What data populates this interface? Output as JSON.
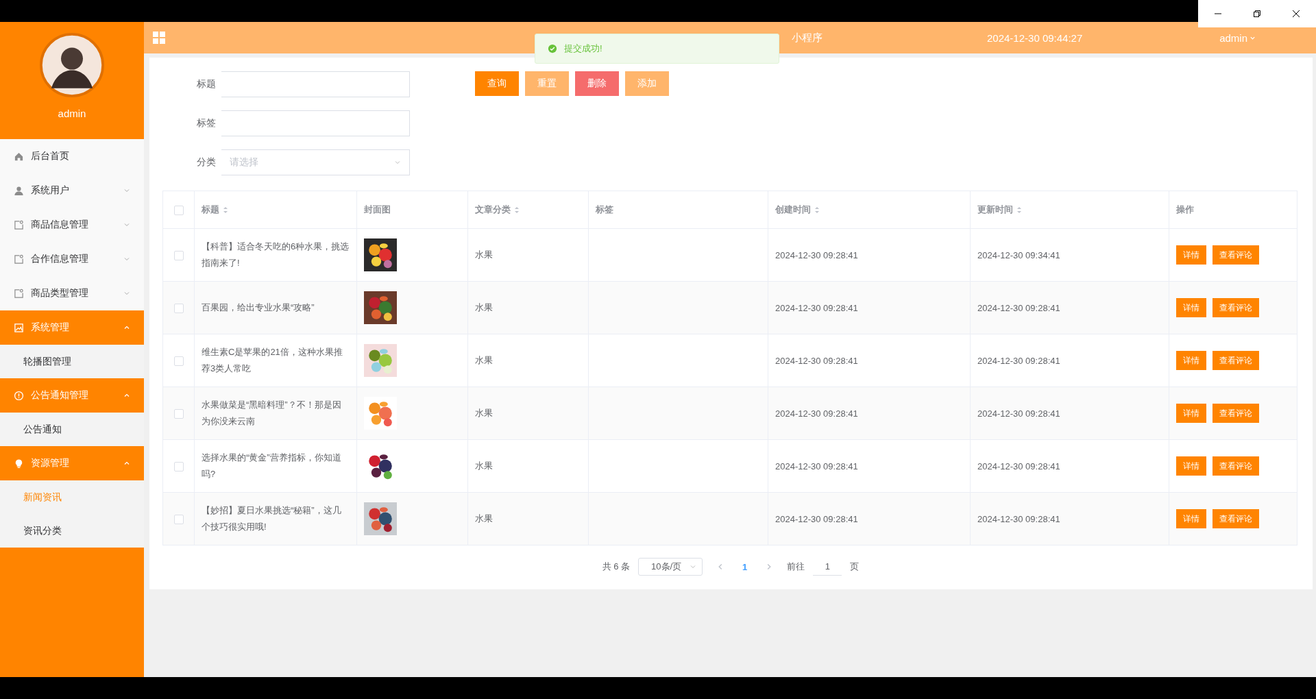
{
  "header": {
    "title": "小程序",
    "datetime": "2024-12-30 09:44:27",
    "user": "admin"
  },
  "toast": {
    "kind": "success",
    "text": "提交成功!"
  },
  "sidebar": {
    "username": "admin",
    "items": [
      {
        "label": "后台首页",
        "kind": "link",
        "expanded": false
      },
      {
        "label": "系统用户",
        "kind": "submenu",
        "expanded": false
      },
      {
        "label": "商品信息管理",
        "kind": "submenu",
        "expanded": false
      },
      {
        "label": "合作信息管理",
        "kind": "submenu",
        "expanded": false
      },
      {
        "label": "商品类型管理",
        "kind": "submenu",
        "expanded": false
      },
      {
        "label": "系统管理",
        "kind": "submenu",
        "expanded": true,
        "children": [
          {
            "label": "轮播图管理",
            "selected": false
          }
        ]
      },
      {
        "label": "公告通知管理",
        "kind": "submenu",
        "expanded": true,
        "children": [
          {
            "label": "公告通知",
            "selected": false
          }
        ]
      },
      {
        "label": "资源管理",
        "kind": "submenu",
        "expanded": true,
        "children": [
          {
            "label": "新闻资讯",
            "selected": true
          },
          {
            "label": "资讯分类",
            "selected": false
          }
        ]
      }
    ]
  },
  "filters": [
    {
      "label": "标题",
      "kind": "input"
    },
    {
      "label": "标签",
      "kind": "input"
    },
    {
      "label": "分类",
      "kind": "select",
      "placeholder": "请选择"
    }
  ],
  "buttons": [
    {
      "label": "查询",
      "kind": "primary"
    },
    {
      "label": "重置",
      "kind": "light"
    },
    {
      "label": "删除",
      "kind": "danger"
    },
    {
      "label": "添加",
      "kind": "light"
    }
  ],
  "table": {
    "select_all": {
      "checked": false
    },
    "columns": [
      {
        "label": "标题",
        "sortable": true
      },
      {
        "label": "封面图",
        "sortable": false
      },
      {
        "label": "文章分类",
        "sortable": true
      },
      {
        "label": "标签",
        "sortable": false
      },
      {
        "label": "创建时间",
        "sortable": true
      },
      {
        "label": "更新时间",
        "sortable": true
      },
      {
        "label": "操作",
        "sortable": false
      }
    ],
    "rows": [
      {
        "checked": false,
        "title": "【科普】适合冬天吃的6种水果，挑选指南来了!",
        "category": "水果",
        "created": "2024-12-30 09:28:41",
        "updated": "2024-12-30 09:34:41",
        "actions": [
          "详情",
          "查看评论"
        ]
      },
      {
        "checked": false,
        "title": "百果园，给出专业水果“攻略”",
        "category": "水果",
        "created": "2024-12-30 09:28:41",
        "updated": "2024-12-30 09:28:41",
        "actions": [
          "详情",
          "查看评论"
        ]
      },
      {
        "checked": false,
        "title": "维生素C是苹果的21倍，这种水果推荐3类人常吃",
        "category": "水果",
        "created": "2024-12-30 09:28:41",
        "updated": "2024-12-30 09:28:41",
        "actions": [
          "详情",
          "查看评论"
        ]
      },
      {
        "checked": false,
        "title": "水果做菜是“黑暗料理”？不！那是因为你没来云南",
        "category": "水果",
        "created": "2024-12-30 09:28:41",
        "updated": "2024-12-30 09:28:41",
        "actions": [
          "详情",
          "查看评论"
        ]
      },
      {
        "checked": false,
        "title": "选择水果的“黄金”营养指标，你知道吗?",
        "category": "水果",
        "created": "2024-12-30 09:28:41",
        "updated": "2024-12-30 09:28:41",
        "actions": [
          "详情",
          "查看评论"
        ]
      },
      {
        "checked": false,
        "title": "【妙招】夏日水果挑选“秘籍”，这几个技巧很实用哦!",
        "category": "水果",
        "created": "2024-12-30 09:28:41",
        "updated": "2024-12-30 09:28:41",
        "actions": [
          "详情",
          "查看评论"
        ]
      }
    ]
  },
  "pagination": {
    "total": "共 6 条",
    "page_size": "10条/页",
    "pages": [
      {
        "label": "1",
        "selected": true
      }
    ],
    "goto_label": "前往",
    "goto_value": "1",
    "goto_suffix": "页"
  }
}
